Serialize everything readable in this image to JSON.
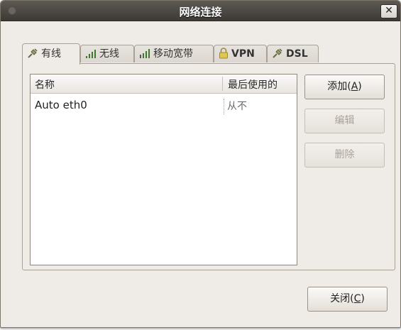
{
  "window": {
    "title": "网络连接",
    "close_symbol": "✕"
  },
  "tabs": [
    {
      "label": "有线",
      "icon": "plug-icon"
    },
    {
      "label": "无线",
      "icon": "wifi-signal-icon"
    },
    {
      "label": "移动宽带",
      "icon": "mobile-signal-icon"
    },
    {
      "label": "VPN",
      "icon": "lock-icon"
    },
    {
      "label": "DSL",
      "icon": "plug-icon"
    }
  ],
  "list": {
    "columns": {
      "name": "名称",
      "last_used": "最后使用的"
    },
    "rows": [
      {
        "name": "Auto eth0",
        "last_used": "从不"
      }
    ]
  },
  "buttons": {
    "add": {
      "label": "添加(",
      "mnemonic": "A",
      "suffix": ")"
    },
    "edit": {
      "label": "编辑"
    },
    "delete": {
      "label": "删除"
    },
    "close": {
      "label": "关闭(",
      "mnemonic": "C",
      "suffix": ")"
    }
  }
}
